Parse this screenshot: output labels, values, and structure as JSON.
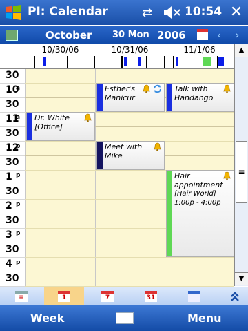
{
  "titlebar": {
    "app_title": "PI: Calendar",
    "time": "10:54",
    "close_label": "✕"
  },
  "datenav": {
    "month": "October",
    "day": "30 Mon",
    "year": "2006",
    "prev_label": "‹",
    "next_label": "›"
  },
  "days": [
    {
      "date": "10/30/06"
    },
    {
      "date": "10/31/06"
    },
    {
      "date": "11/1/06"
    }
  ],
  "hours": [
    {
      "hour": "30",
      "ampm": ""
    },
    {
      "hour": "10",
      "ampm": "a"
    },
    {
      "hour": "30",
      "ampm": ""
    },
    {
      "hour": "11",
      "ampm": "a"
    },
    {
      "hour": "30",
      "ampm": ""
    },
    {
      "hour": "12",
      "ampm": "p"
    },
    {
      "hour": "30",
      "ampm": ""
    },
    {
      "hour": "1",
      "ampm": "p"
    },
    {
      "hour": "30",
      "ampm": ""
    },
    {
      "hour": "2",
      "ampm": "p"
    },
    {
      "hour": "30",
      "ampm": ""
    },
    {
      "hour": "3",
      "ampm": "p"
    },
    {
      "hour": "30",
      "ampm": ""
    },
    {
      "hour": "4",
      "ampm": "p"
    },
    {
      "hour": "30",
      "ampm": ""
    }
  ],
  "appointments": [
    {
      "title": "Esther's Manicur",
      "location": "",
      "time": "",
      "color": "#1a2fe0"
    },
    {
      "title": "Talk with Handango",
      "location": "",
      "time": "",
      "color": "#1a2fe0"
    },
    {
      "title": "Dr. White",
      "location": "[Office]",
      "time": "",
      "color": "#1a2fe0"
    },
    {
      "title": "Meet with Mike",
      "location": "",
      "time": "",
      "color": "#141460"
    },
    {
      "title": "Hair appointment",
      "location": "[Hair World]",
      "time": "1:00p - 4:00p",
      "color": "#5fd855"
    }
  ],
  "viewtabs": {
    "week_num": "7",
    "month_num": "31",
    "day_num": "1"
  },
  "softkeys": {
    "left": "Week",
    "right": "Menu"
  }
}
